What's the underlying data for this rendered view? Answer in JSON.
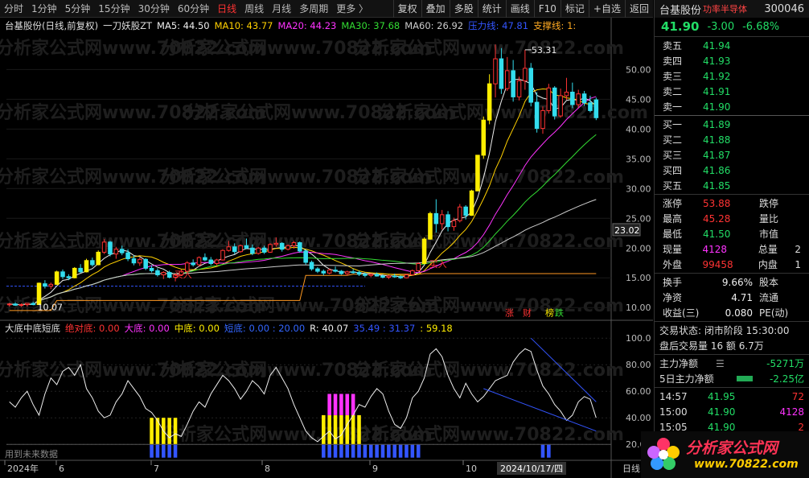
{
  "toolbar": {
    "periods": [
      "分时",
      "1分钟",
      "5分钟",
      "15分钟",
      "30分钟",
      "60分钟",
      "日线",
      "周线",
      "月线",
      "多周期",
      "更多 〉"
    ],
    "active_period": "日线",
    "buttons": [
      "复权",
      "叠加",
      "多股",
      "统计",
      "画线",
      "F10",
      "标记",
      "+自选",
      "返回"
    ]
  },
  "legend_main": {
    "title": "台基股份(日线,前复权)",
    "indicator": "一刀妖股ZT",
    "ma5": "MA5: 44.50",
    "ma10": "MA10: 43.77",
    "ma20": "MA20: 44.23",
    "ma30": "MA30: 37.68",
    "ma60": "MA60: 26.92",
    "pressure": "压力线: 47.81",
    "support": "支撑线: 1:"
  },
  "legend_indicator": {
    "title": "大底中底短底",
    "abs_bottom": "绝对底: 0.00",
    "big_bottom": "大底: 0.00",
    "mid_bottom": "中底: 0.00",
    "short_bottom": "短底: 0.00 : 20.00",
    "r": "R: 40.07",
    "extra": "35.49 : 31.37",
    "extra2": ": 59.18"
  },
  "price_axis": [
    "50.00",
    "45.00",
    "40.00",
    "35.00",
    "30.00",
    "25.00",
    "20.00",
    "15.00",
    "10.00"
  ],
  "price_axis_values": [
    50,
    45,
    40,
    35,
    30,
    25,
    20,
    15,
    10
  ],
  "indicator_axis": [
    "100.0",
    "80.00",
    "60.00",
    "40.00",
    "20.00"
  ],
  "indicator_axis_values": [
    100,
    80,
    60,
    40,
    20
  ],
  "current_price_tag": "23.02",
  "date_axis": [
    "2024年",
    "6",
    "7",
    "8",
    "9",
    "10"
  ],
  "date_cursor": "2024/10/17/四",
  "date_axis_right": "日线",
  "annotations": {
    "high": "53.31",
    "low": "10.07",
    "buy1": "买入",
    "buy2": "买入",
    "tag_zhang": "涨",
    "tag_cai": "财",
    "tag_bang": "榜",
    "tag_die": "跌"
  },
  "bottom_note": "用到未来数据",
  "quote": {
    "name": "台基股份",
    "sector": "功率半导体",
    "code": "300046",
    "price": "41.90",
    "change": "-3.00",
    "pct": "-6.68%",
    "asks": [
      {
        "label": "卖五",
        "price": "41.94"
      },
      {
        "label": "卖四",
        "price": "41.93"
      },
      {
        "label": "卖三",
        "price": "41.92"
      },
      {
        "label": "卖二",
        "price": "41.91"
      },
      {
        "label": "卖一",
        "price": "41.90"
      }
    ],
    "bids": [
      {
        "label": "买一",
        "price": "41.89"
      },
      {
        "label": "买二",
        "price": "41.88"
      },
      {
        "label": "买三",
        "price": "41.87"
      },
      {
        "label": "买四",
        "price": "41.86"
      },
      {
        "label": "买五",
        "price": "41.85"
      }
    ],
    "stats": [
      {
        "l1": "涨停",
        "v1": "53.88",
        "c1": "red",
        "l2": "跌停",
        "v2": ""
      },
      {
        "l1": "最高",
        "v1": "45.28",
        "c1": "red",
        "l2": "量比",
        "v2": ""
      },
      {
        "l1": "最低",
        "v1": "41.50",
        "c1": "green",
        "l2": "市值",
        "v2": ""
      },
      {
        "l1": "现量",
        "v1": "4128",
        "c1": "magenta",
        "l2": "总量",
        "v2": "2"
      },
      {
        "l1": "外盘",
        "v1": "99458",
        "c1": "red",
        "l2": "内盘",
        "v2": "1"
      }
    ],
    "stats2": [
      {
        "l1": "换手",
        "v1": "9.66%",
        "l2": "股本"
      },
      {
        "l1": "净资",
        "v1": "4.71",
        "l2": "流通"
      },
      {
        "l1": "收益(三)",
        "v1": "0.080",
        "l2": "PE(动)"
      }
    ],
    "trade_status": "交易状态: 闭市阶段 15:30:00",
    "after_hours": "盘后交易量 16 额 6.7万",
    "main_net_label": "主力净额",
    "main_net_value": "-5271万",
    "main_net5_label": "5日主力净额",
    "main_net5_value": "-2.25亿",
    "ticks": [
      {
        "time": "14:57",
        "price": "41.95",
        "vol": "72",
        "c": "red"
      },
      {
        "time": "15:00",
        "price": "41.90",
        "vol": "4128",
        "c": "magenta"
      },
      {
        "time": "15:05",
        "price": "41.90",
        "vol": "2",
        "c": "red"
      }
    ]
  },
  "logo": {
    "title": "分析家公式网",
    "url": "www.70822.com"
  },
  "watermark": "分析家公式网www.70822.com",
  "chart_data": {
    "type": "candlestick",
    "price_range": [
      8,
      56
    ],
    "indicator_range": [
      8,
      108
    ],
    "candles": [
      [
        10.5,
        10.8,
        10.2,
        10.6
      ],
      [
        10.6,
        10.9,
        10.3,
        10.4
      ],
      [
        10.4,
        10.7,
        10.1,
        10.5
      ],
      [
        10.5,
        10.8,
        10.2,
        10.7
      ],
      [
        10.7,
        11,
        10.4,
        10.5
      ],
      [
        10.5,
        14.2,
        10.5,
        14.1
      ],
      [
        14,
        14.6,
        13.2,
        13.6
      ],
      [
        13.6,
        14.2,
        13.1,
        13.9
      ],
      [
        13.9,
        16.2,
        13.8,
        16
      ],
      [
        16,
        16.4,
        14.8,
        15.2
      ],
      [
        15.2,
        15.6,
        14.6,
        15
      ],
      [
        15,
        16.8,
        14.9,
        16.6
      ],
      [
        16.6,
        17.3,
        15.8,
        16
      ],
      [
        16,
        18.2,
        15.9,
        17.9
      ],
      [
        17.9,
        18.4,
        16.9,
        17.2
      ],
      [
        17.2,
        19.6,
        17.1,
        19.3
      ],
      [
        19.3,
        21.5,
        19,
        21
      ],
      [
        21,
        21.2,
        18.6,
        19
      ],
      [
        19,
        20.2,
        18.2,
        19.8
      ],
      [
        19.8,
        20.4,
        18.8,
        19.2
      ],
      [
        19.2,
        19.8,
        17.8,
        18.2
      ],
      [
        18.2,
        18.8,
        17.1,
        17.5
      ],
      [
        17.5,
        18.4,
        17,
        18.1
      ],
      [
        18.1,
        18.3,
        16.3,
        16.6
      ],
      [
        16.6,
        17.1,
        15.9,
        16.2
      ],
      [
        16.2,
        16.6,
        15.2,
        15.5
      ],
      [
        15.5,
        16.1,
        14.8,
        15.9
      ],
      [
        15.9,
        16.2,
        14.9,
        15.1
      ],
      [
        15.1,
        15.7,
        14.4,
        15.5
      ],
      [
        15.5,
        16.4,
        15.3,
        16.1
      ],
      [
        16.1,
        17.8,
        16,
        17.5
      ],
      [
        17.5,
        18.1,
        16.9,
        17.2
      ],
      [
        17.2,
        18.6,
        16.9,
        18.4
      ],
      [
        18.4,
        19.1,
        17.8,
        18
      ],
      [
        18,
        18.5,
        17.1,
        17.4
      ],
      [
        17.4,
        18.2,
        17,
        18
      ],
      [
        18,
        19.8,
        17.9,
        19.6
      ],
      [
        19.6,
        21.2,
        19.4,
        20.2
      ],
      [
        20.2,
        20.8,
        19,
        19.4
      ],
      [
        19.4,
        20.6,
        19.2,
        20.4
      ],
      [
        20.4,
        21.6,
        19.8,
        20
      ],
      [
        20,
        20.6,
        18.8,
        19.1
      ],
      [
        19.1,
        20.2,
        18.9,
        20
      ],
      [
        20,
        20.4,
        19,
        19.3
      ],
      [
        19.3,
        20.8,
        19.2,
        20.6
      ],
      [
        20.6,
        21.8,
        20.2,
        20.8
      ],
      [
        20.8,
        21,
        19.4,
        19.8
      ],
      [
        19.8,
        20.6,
        19.6,
        20.4
      ],
      [
        20.4,
        21.2,
        19.9,
        20.9
      ],
      [
        20.9,
        21.1,
        19.2,
        19.5
      ],
      [
        19.5,
        19.8,
        17.2,
        17.6
      ],
      [
        17.6,
        17.9,
        16.2,
        16.5
      ],
      [
        16.5,
        16.8,
        15.8,
        16.1
      ],
      [
        16.1,
        16.4,
        15.4,
        15.8
      ],
      [
        15.8,
        16.6,
        15.6,
        16.3
      ],
      [
        16.3,
        16.9,
        15.9,
        16.1
      ],
      [
        16.1,
        16.3,
        15.5,
        15.7
      ],
      [
        15.7,
        16.2,
        15.4,
        16
      ],
      [
        16,
        16.5,
        15.7,
        15.9
      ],
      [
        15.9,
        16.2,
        15.3,
        15.6
      ],
      [
        15.6,
        15.9,
        15.1,
        15.4
      ],
      [
        15.4,
        15.8,
        15.1,
        15.6
      ],
      [
        15.6,
        15.9,
        15.2,
        15.3
      ],
      [
        15.3,
        15.6,
        14.9,
        15.1
      ],
      [
        15.1,
        15.5,
        14.8,
        15.3
      ],
      [
        15.3,
        15.7,
        15,
        15.2
      ],
      [
        15.2,
        15.4,
        14.8,
        15
      ],
      [
        15,
        15.6,
        14.9,
        15.5
      ],
      [
        15.5,
        16.4,
        15.4,
        16.2
      ],
      [
        16.2,
        17.6,
        16.1,
        17.4
      ],
      [
        17.4,
        21.8,
        17.3,
        21.5
      ],
      [
        21.5,
        26.1,
        21.4,
        25.8
      ],
      [
        25.8,
        28.2,
        22.6,
        24.1
      ],
      [
        24.1,
        26.4,
        23.1,
        25.6
      ],
      [
        25.6,
        26.2,
        22.8,
        23.6
      ],
      [
        23.6,
        25.1,
        22.9,
        24.6
      ],
      [
        24.6,
        27.4,
        24.3,
        26.9
      ],
      [
        26.9,
        27.2,
        24.8,
        25.5
      ],
      [
        25.5,
        29.8,
        25.4,
        29.6
      ],
      [
        29.6,
        35.6,
        29.6,
        35.6
      ],
      [
        35.6,
        42.1,
        35,
        41.5
      ],
      [
        41.5,
        49.2,
        40.8,
        47.6
      ],
      [
        47.6,
        54.2,
        45.3,
        51.8
      ],
      [
        51.8,
        53.6,
        45.9,
        46.8
      ],
      [
        46.8,
        52.1,
        46.4,
        49.8
      ],
      [
        49.8,
        51.6,
        44.6,
        45.4
      ],
      [
        45.4,
        48.8,
        44.8,
        48.1
      ],
      [
        48.1,
        53.3,
        46.6,
        50.2
      ],
      [
        50.2,
        51.1,
        43.8,
        44.5
      ],
      [
        44.5,
        46.2,
        39.4,
        40.1
      ],
      [
        40.1,
        43.8,
        39.2,
        43.1
      ],
      [
        43.1,
        47.6,
        42.6,
        46.9
      ],
      [
        46.9,
        47.2,
        41.6,
        42.2
      ],
      [
        42.2,
        46.8,
        41.9,
        45.6
      ],
      [
        45.6,
        48.6,
        44.9,
        46.2
      ],
      [
        46.2,
        47.8,
        43.5,
        44.1
      ],
      [
        44.1,
        46.6,
        43.6,
        45.9
      ],
      [
        45.9,
        46.4,
        43.9,
        44.4
      ],
      [
        44.4,
        45.6,
        42.8,
        43.1
      ],
      [
        44.9,
        45.28,
        41.5,
        41.9
      ]
    ],
    "indicator_r": [
      52,
      48,
      55,
      60,
      50,
      42,
      58,
      70,
      65,
      75,
      78,
      72,
      80,
      62,
      55,
      45,
      40,
      42,
      52,
      58,
      68,
      62,
      56,
      47,
      44,
      38,
      30,
      25,
      28,
      26,
      35,
      45,
      52,
      48,
      58,
      65,
      72,
      68,
      62,
      54,
      60,
      68,
      64,
      58,
      72,
      78,
      70,
      62,
      50,
      40,
      30,
      25,
      22,
      26,
      30,
      24,
      27,
      35,
      42,
      50,
      48,
      56,
      62,
      58,
      45,
      35,
      32,
      40,
      55,
      60,
      70,
      88,
      92,
      86,
      72,
      62,
      55,
      66,
      58,
      52,
      56,
      62,
      68,
      70,
      72,
      82,
      88,
      92,
      90,
      76,
      64,
      58,
      50,
      45,
      38,
      42,
      52,
      56,
      54,
      40
    ]
  }
}
